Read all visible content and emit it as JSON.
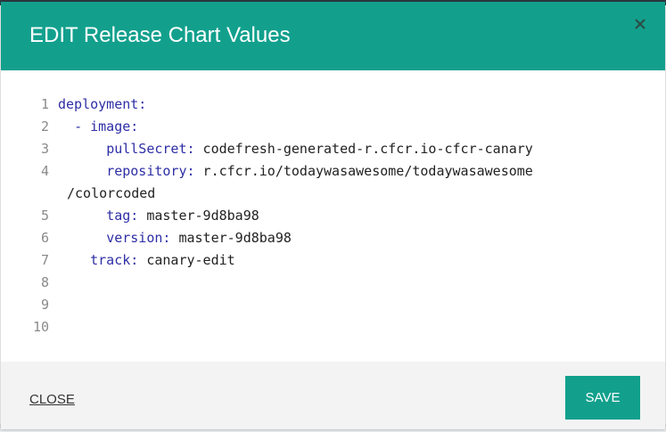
{
  "modal": {
    "title": "EDIT Release Chart Values",
    "close_icon": "close-icon",
    "footer": {
      "close_label": "CLOSE",
      "save_label": "SAVE"
    }
  },
  "editor": {
    "lines": [
      {
        "num": "1",
        "indent": "",
        "dash": "",
        "key": "deployment:",
        "value": ""
      },
      {
        "num": "2",
        "indent": "  ",
        "dash": "- ",
        "key": "image:",
        "value": ""
      },
      {
        "num": "3",
        "indent": "      ",
        "dash": "",
        "key": "pullSecret:",
        "value": " codefresh-generated-r.cfcr.io-cfcr-canary"
      },
      {
        "num": "4",
        "indent": "      ",
        "dash": "",
        "key": "repository:",
        "value": " r.cfcr.io/todaywasawesome/todaywasawesome"
      },
      {
        "num": "5",
        "indent": "      ",
        "dash": "",
        "key": "tag:",
        "value": " master-9d8ba98"
      },
      {
        "num": "6",
        "indent": "      ",
        "dash": "",
        "key": "version:",
        "value": " master-9d8ba98"
      },
      {
        "num": "7",
        "indent": "    ",
        "dash": "",
        "key": "track:",
        "value": " canary-edit"
      },
      {
        "num": "8",
        "indent": "",
        "dash": "",
        "key": "",
        "value": ""
      },
      {
        "num": "9",
        "indent": "",
        "dash": "",
        "key": "",
        "value": ""
      },
      {
        "num": "10",
        "indent": "",
        "dash": "",
        "key": "",
        "value": ""
      }
    ],
    "wrapped_continuation": "/colorcoded"
  },
  "colors": {
    "accent": "#12a08d",
    "yaml_key": "#2e2ea6",
    "line_number": "#8a8a8a"
  }
}
